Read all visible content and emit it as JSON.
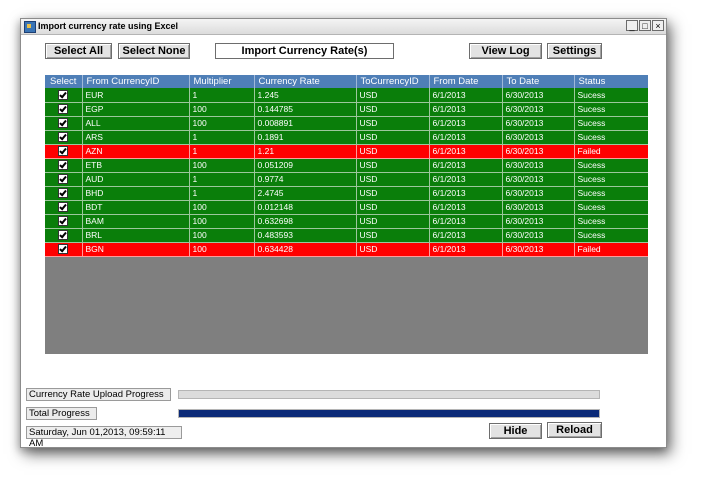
{
  "window": {
    "title": "Import currency rate using Excel",
    "minimize": "_",
    "maximize": "□",
    "close": "×"
  },
  "toolbar": {
    "select_all": "Select All",
    "select_none": "Select None",
    "heading": "Import Currency Rate(s)",
    "view_log": "View Log",
    "settings": "Settings"
  },
  "table": {
    "columns": [
      "Select",
      "From CurrencyID",
      "Multiplier",
      "Currency Rate",
      "ToCurrencyID",
      "From Date",
      "To Date",
      "Status"
    ],
    "rows": [
      {
        "from": "EUR",
        "multiplier": "1",
        "rate": "1.245",
        "to": "USD",
        "from_date": "6/1/2013",
        "to_date": "6/30/2013",
        "status": "Sucess",
        "failed": false
      },
      {
        "from": "EGP",
        "multiplier": "100",
        "rate": "0.144785",
        "to": "USD",
        "from_date": "6/1/2013",
        "to_date": "6/30/2013",
        "status": "Sucess",
        "failed": false
      },
      {
        "from": "ALL",
        "multiplier": "100",
        "rate": "0.008891",
        "to": "USD",
        "from_date": "6/1/2013",
        "to_date": "6/30/2013",
        "status": "Sucess",
        "failed": false
      },
      {
        "from": "ARS",
        "multiplier": "1",
        "rate": "0.1891",
        "to": "USD",
        "from_date": "6/1/2013",
        "to_date": "6/30/2013",
        "status": "Sucess",
        "failed": false
      },
      {
        "from": "AZN",
        "multiplier": "1",
        "rate": "1.21",
        "to": "USD",
        "from_date": "6/1/2013",
        "to_date": "6/30/2013",
        "status": "Failed",
        "failed": true
      },
      {
        "from": "ETB",
        "multiplier": "100",
        "rate": "0.051209",
        "to": "USD",
        "from_date": "6/1/2013",
        "to_date": "6/30/2013",
        "status": "Sucess",
        "failed": false
      },
      {
        "from": "AUD",
        "multiplier": "1",
        "rate": "0.9774",
        "to": "USD",
        "from_date": "6/1/2013",
        "to_date": "6/30/2013",
        "status": "Sucess",
        "failed": false
      },
      {
        "from": "BHD",
        "multiplier": "1",
        "rate": "2.4745",
        "to": "USD",
        "from_date": "6/1/2013",
        "to_date": "6/30/2013",
        "status": "Sucess",
        "failed": false
      },
      {
        "from": "BDT",
        "multiplier": "100",
        "rate": "0.012148",
        "to": "USD",
        "from_date": "6/1/2013",
        "to_date": "6/30/2013",
        "status": "Sucess",
        "failed": false
      },
      {
        "from": "BAM",
        "multiplier": "100",
        "rate": "0.632698",
        "to": "USD",
        "from_date": "6/1/2013",
        "to_date": "6/30/2013",
        "status": "Sucess",
        "failed": false
      },
      {
        "from": "BRL",
        "multiplier": "100",
        "rate": "0.483593",
        "to": "USD",
        "from_date": "6/1/2013",
        "to_date": "6/30/2013",
        "status": "Sucess",
        "failed": false
      },
      {
        "from": "BGN",
        "multiplier": "100",
        "rate": "0.634428",
        "to": "USD",
        "from_date": "6/1/2013",
        "to_date": "6/30/2013",
        "status": "Failed",
        "failed": true
      }
    ]
  },
  "progress": {
    "upload_label": "Currency Rate Upload Progress",
    "upload_value": 0,
    "total_label": "Total Progress",
    "total_value": 1.0
  },
  "footer": {
    "timestamp": "Saturday, Jun 01,2013, 09:59:11 AM",
    "hide": "Hide",
    "reload": "Reload"
  },
  "colors": {
    "success_row": "#0a7e0a",
    "failed_row": "#ff0000",
    "header": "#4f7fb7",
    "grid_background": "#7f7f7f",
    "total_progress_fill": "#0b2a78"
  }
}
